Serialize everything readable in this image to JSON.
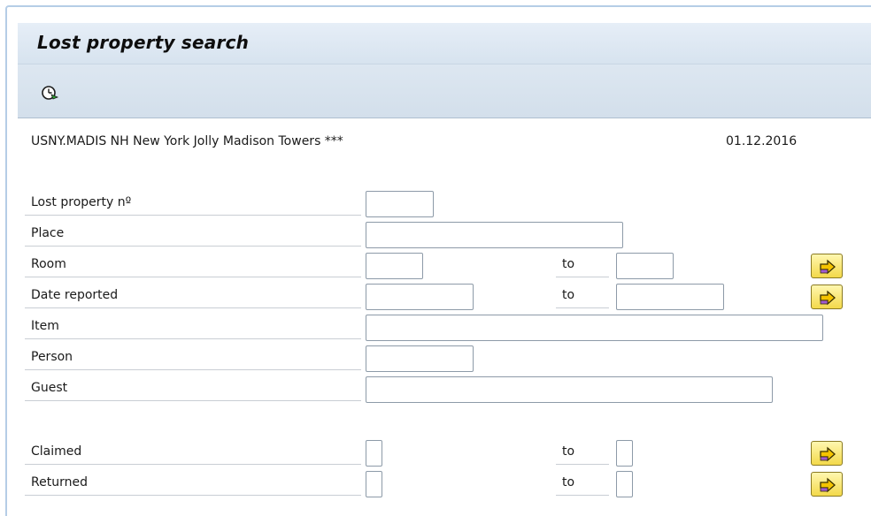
{
  "screen": {
    "title": "Lost property search",
    "toolbar": {
      "execute_icon": "execute-clock-icon"
    },
    "header": {
      "hotel": "USNY.MADIS NH New York Jolly Madison Towers ***",
      "date": "01.12.2016"
    },
    "fields": {
      "lost_property_no": {
        "label": "Lost property nº",
        "value": ""
      },
      "place": {
        "label": "Place",
        "value": ""
      },
      "room": {
        "label": "Room",
        "from": "",
        "to_label": "to",
        "to": ""
      },
      "date_reported": {
        "label": "Date reported",
        "from": "",
        "to_label": "to",
        "to": ""
      },
      "item": {
        "label": "Item",
        "value": ""
      },
      "person": {
        "label": "Person",
        "value": ""
      },
      "guest": {
        "label": "Guest",
        "value": ""
      },
      "claimed": {
        "label": "Claimed",
        "from": "",
        "to_label": "to",
        "to": ""
      },
      "returned": {
        "label": "Returned",
        "from": "",
        "to_label": "to",
        "to": ""
      }
    },
    "colors": {
      "accent_button": "#f3d94a",
      "arrow": "#f5c400"
    }
  }
}
